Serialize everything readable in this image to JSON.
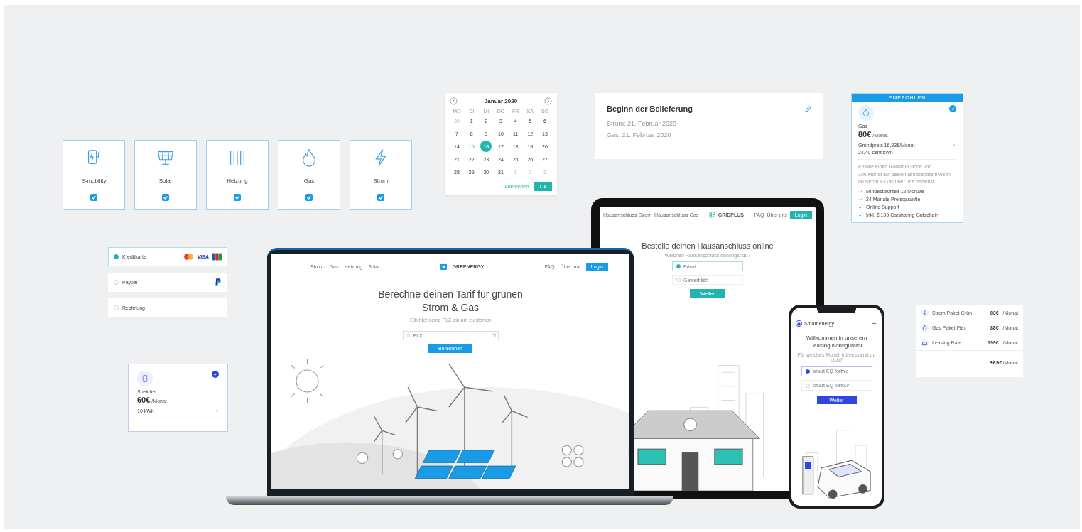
{
  "category_tiles": [
    {
      "label": "E-mobility",
      "checked": true
    },
    {
      "label": "Solar",
      "checked": true
    },
    {
      "label": "Heizung",
      "checked": true
    },
    {
      "label": "Gas",
      "checked": true
    },
    {
      "label": "Strom",
      "checked": true
    }
  ],
  "calendar": {
    "month": "Januar 2020",
    "weekdays": [
      "MO",
      "DI",
      "MI",
      "DO",
      "FR",
      "SA",
      "SO"
    ],
    "days": [
      {
        "label": "30",
        "kind": "outside",
        "selected": false
      },
      {
        "label": "1",
        "kind": "normal",
        "selected": false
      },
      {
        "label": "2",
        "kind": "normal",
        "selected": false
      },
      {
        "label": "3",
        "kind": "normal",
        "selected": false
      },
      {
        "label": "4",
        "kind": "normal",
        "selected": false
      },
      {
        "label": "5",
        "kind": "normal",
        "selected": false
      },
      {
        "label": "6",
        "kind": "normal",
        "selected": false
      },
      {
        "label": "7",
        "kind": "normal",
        "selected": false
      },
      {
        "label": "8",
        "kind": "normal",
        "selected": false
      },
      {
        "label": "9",
        "kind": "normal",
        "selected": false
      },
      {
        "label": "10",
        "kind": "normal",
        "selected": false
      },
      {
        "label": "11",
        "kind": "normal",
        "selected": false
      },
      {
        "label": "12",
        "kind": "normal",
        "selected": false
      },
      {
        "label": "13",
        "kind": "normal",
        "selected": false
      },
      {
        "label": "14",
        "kind": "normal",
        "selected": false
      },
      {
        "label": "15",
        "kind": "today",
        "selected": false
      },
      {
        "label": "16",
        "kind": "normal",
        "selected": true
      },
      {
        "label": "17",
        "kind": "normal",
        "selected": false
      },
      {
        "label": "18",
        "kind": "normal",
        "selected": false
      },
      {
        "label": "19",
        "kind": "normal",
        "selected": false
      },
      {
        "label": "20",
        "kind": "normal",
        "selected": false
      },
      {
        "label": "21",
        "kind": "normal",
        "selected": false
      },
      {
        "label": "22",
        "kind": "normal",
        "selected": false
      },
      {
        "label": "23",
        "kind": "normal",
        "selected": false
      },
      {
        "label": "24",
        "kind": "normal",
        "selected": false
      },
      {
        "label": "25",
        "kind": "normal",
        "selected": false
      },
      {
        "label": "26",
        "kind": "normal",
        "selected": false
      },
      {
        "label": "27",
        "kind": "normal",
        "selected": false
      },
      {
        "label": "28",
        "kind": "normal",
        "selected": false
      },
      {
        "label": "29",
        "kind": "normal",
        "selected": false
      },
      {
        "label": "30",
        "kind": "normal",
        "selected": false
      },
      {
        "label": "31",
        "kind": "normal",
        "selected": false
      },
      {
        "label": "1",
        "kind": "outside",
        "selected": false
      },
      {
        "label": "2",
        "kind": "outside",
        "selected": false
      },
      {
        "label": "3",
        "kind": "outside",
        "selected": false
      }
    ],
    "cancel": "Abbrechen",
    "ok": "Ok"
  },
  "delivery_card": {
    "title": "Beginn der Belieferung",
    "lines": [
      "Strom: 21. Februar 2020",
      "Gas: 21. Februar 2020"
    ]
  },
  "recommended_card": {
    "badge": "EMPFOHLEN",
    "selected": true,
    "name": "Gas",
    "price": "80€",
    "unit": "/Monat",
    "details": [
      "Grundpreis 16,33€/Monat",
      "24,40 cent/kWh"
    ],
    "note": "Erhalte einen Rabatt in Höhe von 10€/Monat auf deinen Breitbandtarif wenn du Strom & Gas über uns beziehst.",
    "features": [
      "Mindestlaufzeit 12 Monate",
      "24 Monate Preisgarantie",
      "Online Support",
      "Inkl. € 100 Carsharing Gutschein"
    ]
  },
  "payment_options": [
    {
      "label": "Kreditkarte",
      "selected": true,
      "kind": "cards",
      "logo_text": "VISA"
    },
    {
      "label": "Paypal",
      "selected": false,
      "kind": "paypal"
    },
    {
      "label": "Rechnung",
      "selected": false,
      "kind": "plain"
    }
  ],
  "storage_card": {
    "name": "Speicher",
    "price": "60€",
    "unit": "/Monat",
    "option": "10 kWh",
    "selected": true
  },
  "laptop": {
    "nav": [
      "Strom",
      "Gas",
      "Heizung",
      "Solar"
    ],
    "logo": "GREENERGY",
    "nav_right": [
      "FAQ",
      "Über uns"
    ],
    "login": "Login",
    "headline": "Berechne deinen Tarif für grünen Strom & Gas",
    "subline": "Gib hier deine PLZ ein um zu starten",
    "placeholder": "PLZ",
    "button": "Berechnen"
  },
  "tablet": {
    "nav": [
      "Hausanschluss Strom",
      "Hausanschluss Gas"
    ],
    "logo": "GRIDPLUS",
    "nav_right": [
      "FAQ",
      "Über uns"
    ],
    "login": "Login",
    "headline": "Bestelle deinen Hausanschluss online",
    "subline": "Welchen Hausanschluss benötigst du?",
    "options": [
      {
        "label": "Privat",
        "selected": true
      },
      {
        "label": "Gewerblich",
        "selected": false
      }
    ],
    "button": "Weiter"
  },
  "phone": {
    "brand": "Smart energy",
    "headline": "Willkommen in unserem Leasing Konfigurator",
    "subline": "Für welches Modell interessierst du dich?",
    "options": [
      {
        "label": "smart EQ fortwo",
        "selected": true
      },
      {
        "label": "smart EQ forfour",
        "selected": false
      }
    ],
    "button": "Weiter"
  },
  "summary_card": {
    "items": [
      {
        "label": "Strom Paket Grün",
        "price": "83€",
        "unit": "/Monat"
      },
      {
        "label": "Gas Paket Flex",
        "price": "88€",
        "unit": "/Monat"
      },
      {
        "label": "Leasing Rate",
        "price": "199€",
        "unit": "/Monat"
      }
    ],
    "total": "369€",
    "total_unit": "/Monat"
  }
}
